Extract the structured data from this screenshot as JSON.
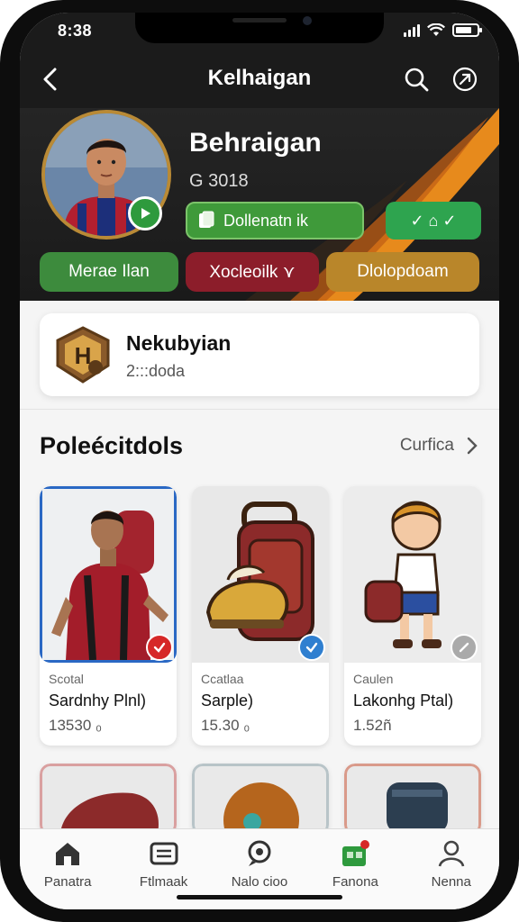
{
  "status_bar": {
    "time": "8:38"
  },
  "header": {
    "title": "Kelhaigan",
    "back_icon": "chevron-left-icon",
    "search_icon": "search-icon",
    "share_icon": "share-icon"
  },
  "profile": {
    "name": "Behraigan",
    "id": "G 3018",
    "collection_chip": "Dollenatn ik",
    "check_chip": "✓ ⌂ ✓",
    "actions": [
      {
        "label": "Merae Ilan",
        "color": "#3d8b3d"
      },
      {
        "label": "Xocleoilk ⋎",
        "color": "#8c1d2a"
      },
      {
        "label": "Dlolopdoam",
        "color": "#b9862a"
      }
    ]
  },
  "rank_card": {
    "title": "Nekubyian",
    "subtitle": "2:::doda"
  },
  "section": {
    "title": "Poleécitdols",
    "link": "Curfica"
  },
  "items": [
    {
      "category": "Scotal",
      "name": "Sardnhy Plnl)",
      "price": "13530 ₀",
      "badge_color": "#d62828",
      "badge_icon": "check-icon"
    },
    {
      "category": "Ccatlaa",
      "name": "Sarple)",
      "price": "15.30 ₀",
      "badge_color": "#2f7fd0",
      "badge_icon": "check-icon"
    },
    {
      "category": "Caulen",
      "name": "Lakonhg Ptal)",
      "price": "1.52ñ",
      "badge_color": "#aaaaaa",
      "badge_icon": "pencil-icon"
    }
  ],
  "nav": [
    {
      "label": "Panatra",
      "icon": "home-icon"
    },
    {
      "label": "Ftlmaak",
      "icon": "wallet-icon"
    },
    {
      "label": "Nalo cioo",
      "icon": "chat-icon"
    },
    {
      "label": "Fanona",
      "icon": "store-icon"
    },
    {
      "label": "Nenna",
      "icon": "profile-icon"
    }
  ],
  "colors": {
    "header_bg": "#1b1b1b",
    "accent_orange": "#f2901c",
    "selected_border": "#2a68c4"
  }
}
